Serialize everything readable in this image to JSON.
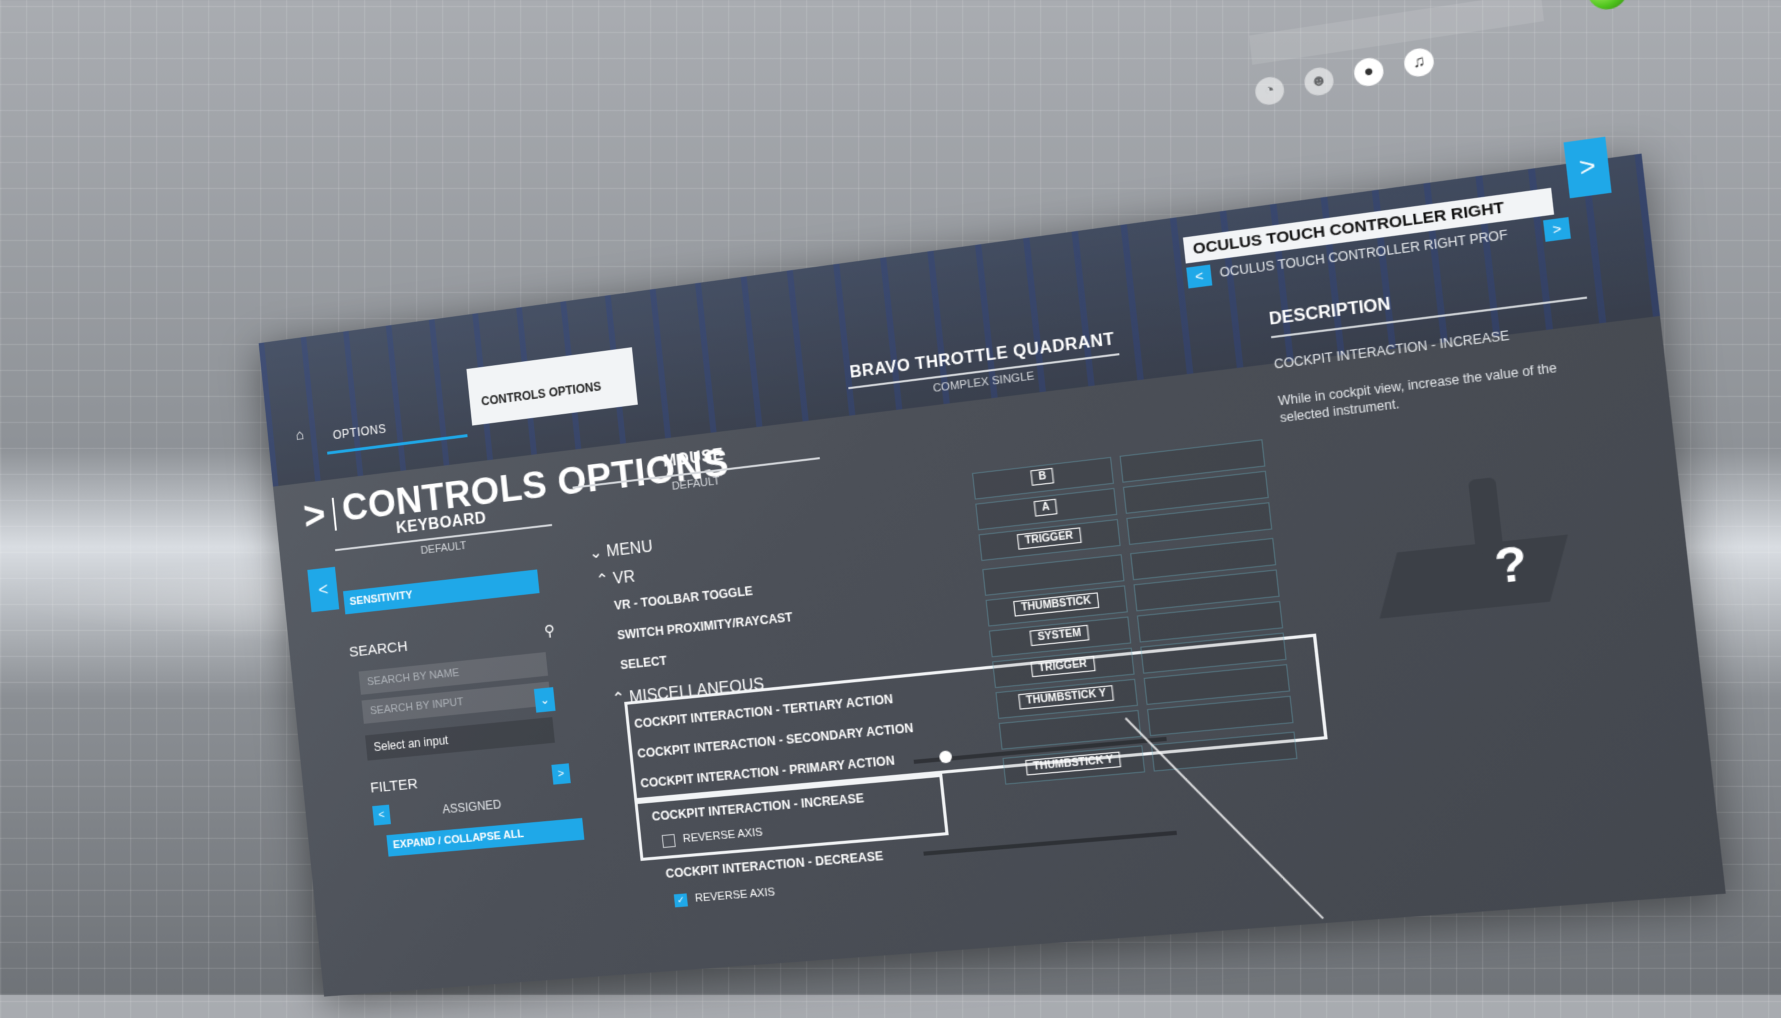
{
  "tabs": {
    "options": "OPTIONS",
    "controls": "CONTROLS OPTIONS"
  },
  "title": "CONTROLS OPTIONS",
  "devices": [
    {
      "name": "KEYBOARD",
      "profile": "DEFAULT"
    },
    {
      "name": "MOUSE",
      "profile": "DEFAULT"
    },
    {
      "name": "BRAVO THROTTLE QUADRANT",
      "profile": "COMPLEX SINGLE"
    }
  ],
  "oculus": {
    "name": "OCULUS TOUCH CONTROLLER RIGHT",
    "profile": "OCULUS TOUCH CONTROLLER RIGHT PROF"
  },
  "sidebar": {
    "sensitivity": "SENSITIVITY",
    "search_label": "SEARCH",
    "search_name_placeholder": "SEARCH BY NAME",
    "search_input_placeholder": "SEARCH BY INPUT",
    "select_input": "Select an input",
    "filter_label": "FILTER",
    "filter_value": "ASSIGNED",
    "expand": "EXPAND / COLLAPSE ALL"
  },
  "list": {
    "menu": "MENU",
    "vr": "VR",
    "vr_toolbar": "VR - TOOLBAR TOGGLE",
    "switch": "SWITCH PROXIMITY/RAYCAST",
    "select": "SELECT",
    "misc": "MISCELLANEOUS",
    "tertiary": "COCKPIT INTERACTION - TERTIARY ACTION",
    "secondary": "COCKPIT INTERACTION - SECONDARY ACTION",
    "primary": "COCKPIT INTERACTION - PRIMARY ACTION",
    "increase": "COCKPIT INTERACTION - INCREASE",
    "reverse1": "REVERSE AXIS",
    "decrease": "COCKPIT INTERACTION - DECREASE",
    "reverse2": "REVERSE AXIS"
  },
  "keys": {
    "b": "B",
    "a": "A",
    "trigger1": "TRIGGER",
    "thumbstick": "THUMBSTICK",
    "system": "SYSTEM",
    "trigger2": "TRIGGER",
    "thumbsticky1": "THUMBSTICK Y",
    "thumbsticky2": "THUMBSTICK Y"
  },
  "description": {
    "heading": "DESCRIPTION",
    "title": "COCKPIT INTERACTION - INCREASE",
    "body": "While in cockpit view, increase the value of the selected instrument."
  },
  "device_placeholder": "?",
  "checks": {
    "reverse1": false,
    "reverse2": true
  },
  "colors": {
    "accent": "#1fa8e8",
    "status": "#4fc41d"
  }
}
